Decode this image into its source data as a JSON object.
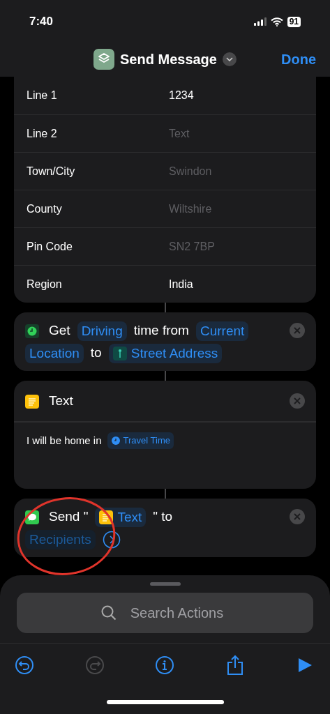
{
  "status_bar": {
    "time": "7:40",
    "battery": "91"
  },
  "nav": {
    "title": "Send Message",
    "done": "Done"
  },
  "address_fields": [
    {
      "label": "Line 1",
      "value": "1234"
    },
    {
      "label": "Line 2",
      "placeholder": "Text"
    },
    {
      "label": "Town/City",
      "placeholder": "Swindon"
    },
    {
      "label": "County",
      "placeholder": "Wiltshire"
    },
    {
      "label": "Pin Code",
      "placeholder": "SN2 7BP"
    },
    {
      "label": "Region",
      "value": "India"
    }
  ],
  "get_action": {
    "parts": [
      {
        "kind": "clock"
      },
      {
        "kind": "text",
        "text": "Get"
      },
      {
        "kind": "token",
        "text": "Driving"
      },
      {
        "kind": "text",
        "text": "time from"
      },
      {
        "kind": "token",
        "text": "Current"
      },
      {
        "kind": "token",
        "text": "Location"
      },
      {
        "kind": "text",
        "text": "to"
      },
      {
        "kind": "address",
        "text": "Street Address"
      }
    ]
  },
  "text_action": {
    "title": "Text",
    "body": [
      {
        "kind": "text",
        "text": "I will be home in"
      },
      {
        "kind": "duration",
        "text": "Travel Time"
      }
    ]
  },
  "send_action": {
    "parts": [
      {
        "kind": "message"
      },
      {
        "kind": "text",
        "text": "Send \""
      },
      {
        "kind": "textvar",
        "text": "Text"
      },
      {
        "kind": "text",
        "text": "\" to"
      },
      {
        "kind": "placeholder",
        "text": "Recipients"
      },
      {
        "kind": "expand"
      }
    ]
  },
  "search": {
    "placeholder": "Search Actions"
  },
  "toolbar": [
    {
      "kind": "undo",
      "disabled": false
    },
    {
      "kind": "redo",
      "disabled": true
    },
    {
      "kind": "info",
      "disabled": false
    },
    {
      "kind": "share",
      "disabled": false
    },
    {
      "kind": "run",
      "disabled": false
    }
  ]
}
